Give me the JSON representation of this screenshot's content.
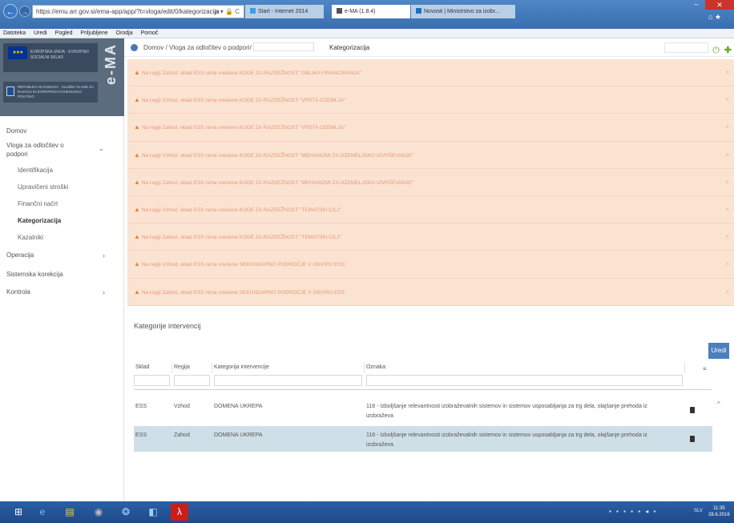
{
  "browser": {
    "url": "https://emu.arr.gov.si/ema-app/app/?t=vloga/edit/0/kategorizacija",
    "tabs": [
      "Start - Internet 2014",
      "e-MA (1.8.4)",
      "Novosti | Ministrstvo za izobr..."
    ],
    "menu": [
      "Datoteka",
      "Uredi",
      "Pogled",
      "Priljubljene",
      "Orodja",
      "Pomoč"
    ],
    "addr_controls": "ρ ▾ 🔒 C",
    "clock_time": "11:35",
    "clock_date": "28.6.2016",
    "lang": "SLV"
  },
  "app": {
    "brand_logo_text": "EVROPSKA UNIJA · EVROPSKI SOCIALNI SKLAD",
    "ministry_text": "REPUBLIKA SLOVENIJA · SLUŽBA VLADE ZA RAZVOJ IN EVROPSKO KOHEZIJSKO POLITIKO",
    "ema_label": "e-MA"
  },
  "sidebar": {
    "items": [
      {
        "label": "Domov"
      },
      {
        "label": "Vloga za odločitev o podpori",
        "chevron": "⌄"
      },
      {
        "label": "Identifikacija"
      },
      {
        "label": "Upravičeni stroški"
      },
      {
        "label": "Finančni načrt"
      },
      {
        "label": "Kategorizacija"
      },
      {
        "label": "Kazalniki"
      },
      {
        "label": "Operacija",
        "chevron": "›"
      },
      {
        "label": "Sistemska korekcija"
      },
      {
        "label": "Kontrola",
        "chevron": "›"
      }
    ]
  },
  "breadcrumb": {
    "home": "Domov",
    "sep": "/",
    "vloga": "Vloga za odločitev o podpori",
    "current": "Kategorizacija"
  },
  "alerts": [
    "Na regiji Zahod, sklad ESS nima vnešene KODE ZA RAZSEŽNOST \"OBLIKA FINANCIRANJA\"",
    "Na regiji Vzhod, sklad ESS nima vnešene KODE ZA RAZSEŽNOST \"VRSTA OZEMLJA\"",
    "Na regiji Zahod, sklad ESS nima vnešene KODE ZA RAZSEŽNOST \"VRSTA OZEMLJA\"",
    "Na regiji Vzhod, sklad ESS nima vnešene KODE ZA RAZSEŽNOST \"MEHANIZMI ZA OZEMELJSKO IZVRŠEVANJE\"",
    "Na regiji Zahod, sklad ESS nima vnešene KODE ZA RAZSEŽNOST \"MEHANIZMI ZA OZEMELJSKO IZVRŠEVANJE\"",
    "Na regiji Vzhod, sklad ESS nima vnešene KODE ZA RAZSEŽNOST \"TEMATSKI CILJ\"",
    "Na regiji Zahod, sklad ESS nima vnešene KODE ZA RAZSEŽNOST \"TEMATSKI CILJ\"",
    "Na regiji Vzhod, sklad ESS nima vnešene SEKUNDARNO PODROČJE V OKVIRU ESS",
    "Na regiji Zahod, sklad ESS nima vnešene SEKUNDARNO PODROČJE V OKVIRU ESS"
  ],
  "interventions": {
    "title": "Kategorije intervencij",
    "edit_label": "Uredi",
    "columns": [
      "Sklad",
      "Regija",
      "Kategorija intervencije",
      "Oznaka"
    ],
    "rows": [
      {
        "sklad": "ESS",
        "regija": "Vzhod",
        "kategorija": "DOMENA UKREPA",
        "oznaka": "118 - Izboljšanje relevantnosti izobraževalnih sistemov in sistemov usposabljanja za trg dela, olajšanje prehoda iz izobraževa"
      },
      {
        "sklad": "ESS",
        "regija": "Zahod",
        "kategorija": "DOMENA UKREPA",
        "oznaka": "118 - Izboljšanje relevantnosti izobraževalnih sistemov in sistemov usposabljanja za trg dela, olajšanje prehoda iz izobraževa"
      }
    ]
  }
}
